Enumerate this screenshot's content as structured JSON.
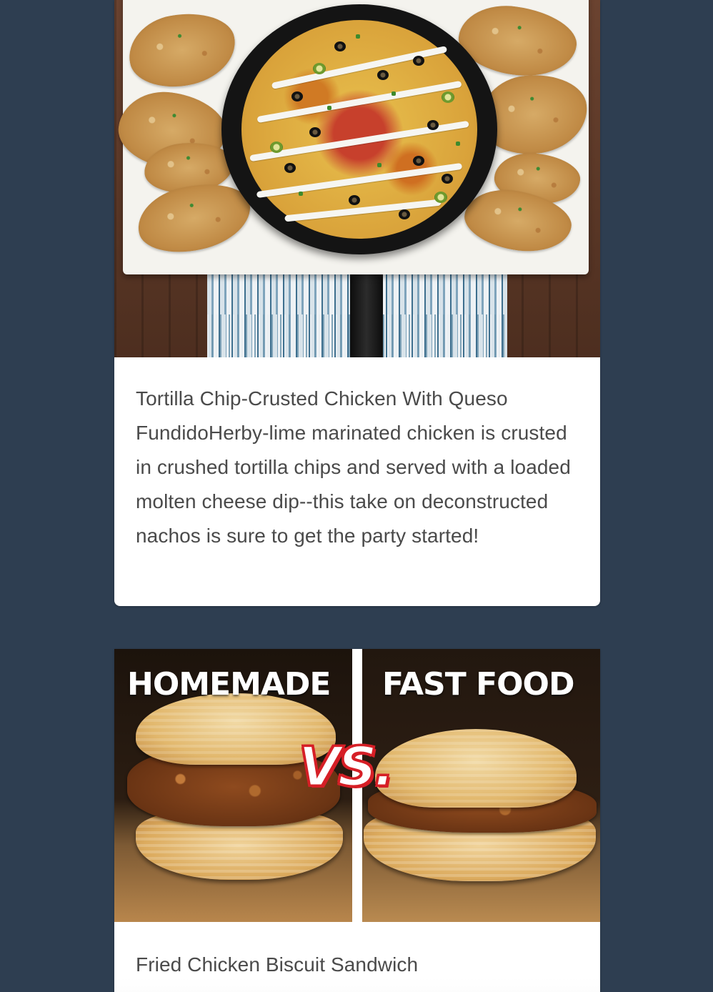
{
  "feed": {
    "items": [
      {
        "caption": "Tortilla Chip-Crusted Chicken With Queso FundidoHerby-lime marinated chicken is crusted in crushed tortilla chips and served with a loaded molten cheese dip--this take on deconstructed nachos is sure to get the party started!",
        "image_icon": "tortilla-chip-chicken-photo"
      },
      {
        "caption": "Fried Chicken Biscuit Sandwich",
        "image_icon": "fried-chicken-biscuit-comparison-photo",
        "image_text": {
          "left": "HOMEMADE",
          "right": "FAST FOOD",
          "center": "VS."
        }
      }
    ]
  },
  "colors": {
    "background": "#2e3e51",
    "card": "#ffffff",
    "caption_text": "#4a4a4a",
    "vs_accent": "#d61f26"
  }
}
